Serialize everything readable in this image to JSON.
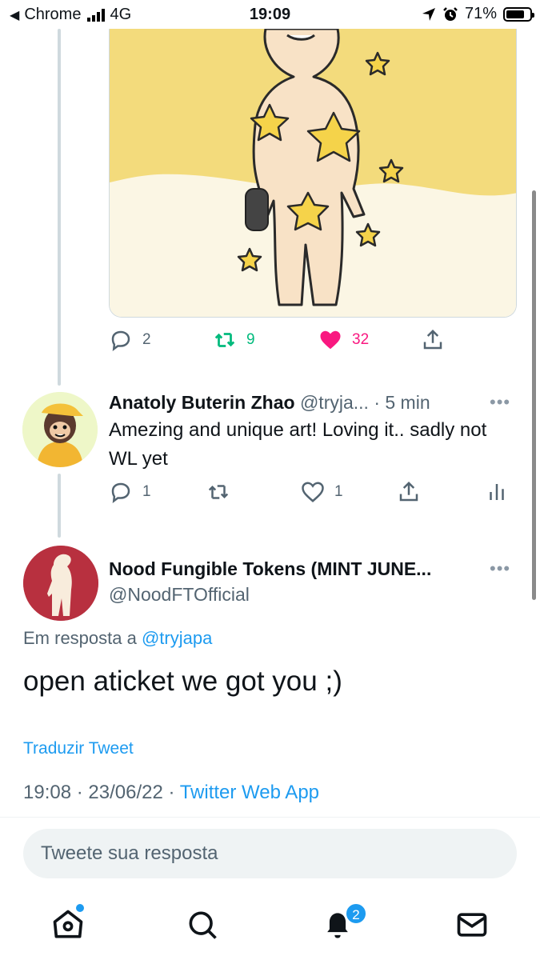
{
  "status_bar": {
    "back_app": "Chrome",
    "network": "4G",
    "time": "19:09",
    "battery": "71%"
  },
  "art_tweet": {
    "reply_count": "2",
    "retweet_count": "9",
    "like_count": "32",
    "colors": {
      "retweet": "#00ba7c",
      "like": "#f91880"
    }
  },
  "reply_tweet": {
    "name": "Anatoly Buterin Zhao",
    "handle": "@tryja...",
    "time": "· 5 min",
    "more": "•••",
    "text": "Amezing and unique art! Loving it.. sadly not WL yet",
    "reply_count": "1",
    "retweet_count": "",
    "like_count": "1"
  },
  "focused_tweet": {
    "name": "Nood Fungible Tokens (MINT JUNE...",
    "handle": "@NoodFTOfficial",
    "more": "•••",
    "replying_prefix": "Em resposta a",
    "replying_handle": "@tryjapa",
    "text": "open aticket we got you ;)",
    "translate": "Traduzir Tweet",
    "timestamp": "19:08 · 23/06/22 ·",
    "source": "Twitter Web App",
    "avatar_color": "#b8303f"
  },
  "composer": {
    "placeholder": "Tweete sua resposta"
  },
  "tabbar": {
    "notification_badge": "2",
    "accent": "#1d9bf0"
  }
}
